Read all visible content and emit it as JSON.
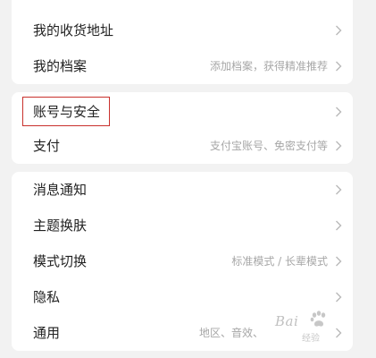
{
  "sections": {
    "top": [
      {
        "label": "我的收货地址",
        "desc": ""
      },
      {
        "label": "我的档案",
        "desc": "添加档案，获得精准推荐"
      }
    ],
    "middle": [
      {
        "label": "账号与安全",
        "desc": ""
      },
      {
        "label": "支付",
        "desc": "支付宝账号、免密支付等"
      }
    ],
    "bottom": [
      {
        "label": "消息通知",
        "desc": ""
      },
      {
        "label": "主题换肤",
        "desc": ""
      },
      {
        "label": "模式切换",
        "desc": "标准模式 / 长辈模式"
      },
      {
        "label": "隐私",
        "desc": ""
      },
      {
        "label": "通用",
        "desc": "地区、音效、"
      }
    ]
  },
  "highlight_color": "#c9302c",
  "watermark": {
    "brand": "Bai",
    "sub": "经验"
  }
}
